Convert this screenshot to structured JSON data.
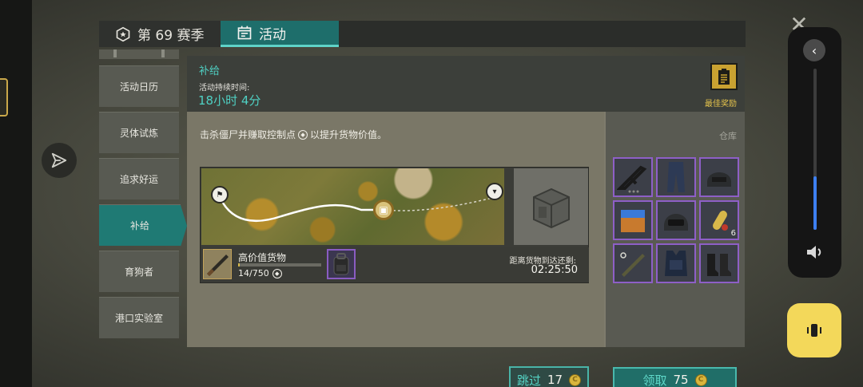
{
  "header": {
    "season_tab": "第 69 赛季",
    "activity_tab": "活动"
  },
  "sidebar": {
    "items": [
      {
        "label": "活动日历",
        "active": false
      },
      {
        "label": "灵体试炼",
        "active": false
      },
      {
        "label": "追求好运",
        "active": false
      },
      {
        "label": "补给",
        "active": true
      },
      {
        "label": "育狗者",
        "active": false
      },
      {
        "label": "港口实验室",
        "active": false
      }
    ]
  },
  "event": {
    "title": "补给",
    "duration_label": "活动持续时间:",
    "duration": "18小时 4分",
    "best_reward_label": "最佳奖励",
    "description": "击杀僵尸并赚取控制点",
    "description_suffix": "以提升货物价值。"
  },
  "cargo": {
    "name": "高价值货物",
    "progress_current": 14,
    "progress_max": 750,
    "progress_text": "14/750",
    "distance_label": "距离货物到达还剩:",
    "distance_time": "02:25:50"
  },
  "actions": {
    "skip_label": "跳过",
    "skip_cost": "17",
    "claim_label": "领取",
    "claim_cost": "75"
  },
  "storage": {
    "title": "仓库",
    "items": [
      {
        "icon": "assault-rifle-icon",
        "qty": ""
      },
      {
        "icon": "tactical-pants-icon",
        "qty": ""
      },
      {
        "icon": "combat-helmet-icon",
        "qty": ""
      },
      {
        "icon": "supply-box-icon",
        "qty": ""
      },
      {
        "icon": "riot-helmet-icon",
        "qty": ""
      },
      {
        "icon": "pill-capsule-icon",
        "qty": "6"
      },
      {
        "icon": "grenade-launcher-icon",
        "qty": ""
      },
      {
        "icon": "body-armor-icon",
        "qty": ""
      },
      {
        "icon": "combat-boots-icon",
        "qty": ""
      }
    ]
  },
  "colors": {
    "accent_teal": "#4fd0c3",
    "active_tab": "#1e6e6b",
    "rarity_purple": "#8e5fc7",
    "gold": "#d9b53c"
  }
}
